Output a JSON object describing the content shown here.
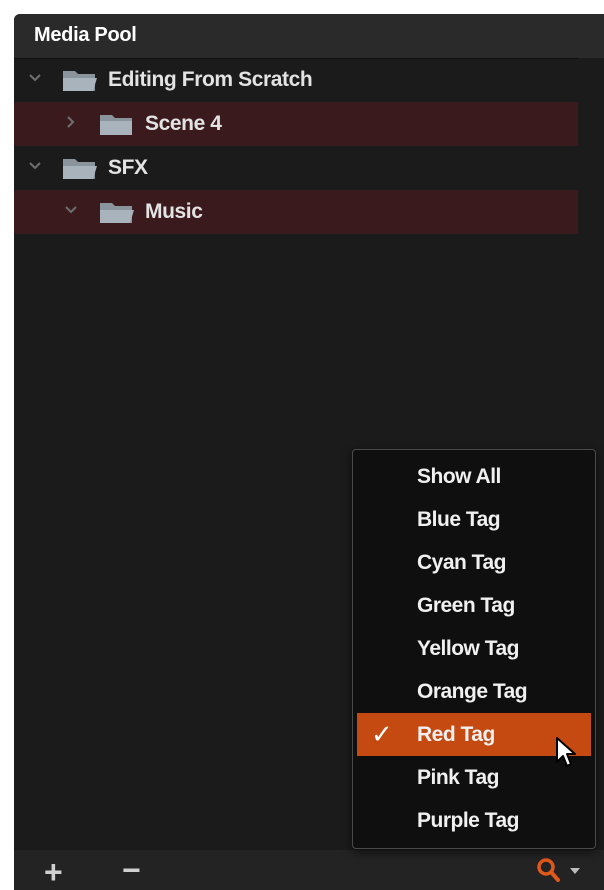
{
  "panel": {
    "title": "Media Pool"
  },
  "tree": {
    "items": [
      {
        "label": "Editing From Scratch",
        "expanded": true,
        "selected": false,
        "level": 0,
        "icon": "folder-open-icon"
      },
      {
        "label": "Scene 4",
        "expanded": false,
        "selected": true,
        "level": 1,
        "icon": "folder-icon"
      },
      {
        "label": "SFX",
        "expanded": true,
        "selected": false,
        "level": 0,
        "icon": "folder-open-icon"
      },
      {
        "label": "Music",
        "expanded": true,
        "selected": true,
        "level": 1,
        "icon": "folder-open-icon"
      }
    ]
  },
  "footer": {
    "add_label": "+",
    "remove_label": "−",
    "search_icon": "search-icon",
    "dropdown_icon": "caret-down-icon"
  },
  "filter_menu": {
    "items": [
      {
        "label": "Show All",
        "checked": false
      },
      {
        "label": "Blue Tag",
        "checked": false
      },
      {
        "label": "Cyan Tag",
        "checked": false
      },
      {
        "label": "Green Tag",
        "checked": false
      },
      {
        "label": "Yellow Tag",
        "checked": false
      },
      {
        "label": "Orange Tag",
        "checked": false
      },
      {
        "label": "Red Tag",
        "checked": true
      },
      {
        "label": "Pink Tag",
        "checked": false
      },
      {
        "label": "Purple Tag",
        "checked": false
      }
    ],
    "check_glyph": "✓"
  },
  "colors": {
    "accent": "#c54a12",
    "search_icon": "#e0581a",
    "selected_row": "#3a1a1d",
    "panel_bg": "#1b1b1c"
  }
}
